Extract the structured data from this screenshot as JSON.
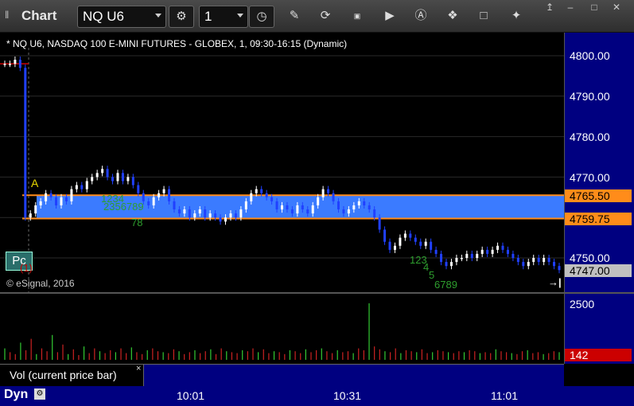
{
  "toolbar": {
    "title": "Chart",
    "symbol": "NQ U6",
    "interval": "1",
    "icons": [
      "settings-gear-icon",
      "clock-icon",
      "pencil-icon",
      "refresh-icon",
      "get-quote-icon",
      "play-icon",
      "alert-icon",
      "link-icon",
      "chat-icon",
      "twitter-icon"
    ],
    "window_controls": [
      "pin",
      "minimize",
      "maximize",
      "close"
    ]
  },
  "chart": {
    "header": "* NQ U6, NASDAQ 100 E-MINI FUTURES - GLOBEX, 1, 09:30-16:15 (Dynamic)",
    "copyright": "© eSignal, 2016",
    "pc_label": "Pc",
    "marker_a": "A",
    "marker_paren": "(1)",
    "end_arrow": "→|"
  },
  "price_axis": {
    "labels": [
      "4800.00",
      "4790.00",
      "4780.00",
      "4770.00",
      "4760.00",
      "4750.00"
    ],
    "tag_upper": "4765.50",
    "tag_lower": "4759.75",
    "tag_last": "4747.00",
    "colors": {
      "upper_bg": "#ff8c1a",
      "lower_bg": "#ff8c1a",
      "last_bg": "#c0c0c0",
      "axis_bg": "#000080"
    }
  },
  "volume": {
    "legend": "Vol (current price bar)",
    "close_icon": "×",
    "axis_label": "2500",
    "tag_last": "142",
    "colors": {
      "tag_bg": "#cc0000",
      "up": "#33cc33",
      "down": "#cc2222"
    }
  },
  "time_axis": {
    "mode": "Dyn",
    "labels": [
      "10:01",
      "10:31",
      "11:01"
    ]
  },
  "td_counts": {
    "left_upper": "1234",
    "left_mid": "2356789",
    "left_low": "78",
    "right_a": "123",
    "right_b": "4",
    "right_c": "5",
    "right_d": "6789"
  },
  "chart_data": {
    "type": "candlestick",
    "title": "* NQ U6, NASDAQ 100 E-MINI FUTURES - GLOBEX, 1, 09:30-16:15 (Dynamic)",
    "ylabel": "",
    "ylim": [
      4744,
      4803
    ],
    "y_ticks": [
      4800,
      4790,
      4780,
      4770,
      4760,
      4750
    ],
    "x_ticks": [
      "10:01",
      "10:31",
      "11:01"
    ],
    "value_area": {
      "high": 4765.5,
      "low": 4759.75
    },
    "last_price": 4747.0,
    "volume_ylim": [
      0,
      2500
    ],
    "volume_last": 142,
    "closes": [
      4798,
      4798,
      4799,
      4797,
      4760,
      4761,
      4763,
      4764,
      4766,
      4765,
      4763,
      4765,
      4764,
      4767,
      4768,
      4767,
      4769,
      4770,
      4771,
      4772,
      4770,
      4769,
      4771,
      4769,
      4770,
      4768,
      4766,
      4764,
      4763,
      4765,
      4766,
      4767,
      4764,
      4762,
      4761,
      4762,
      4760,
      4761,
      4762,
      4760,
      4761,
      4760,
      4759,
      4760,
      4761,
      4760,
      4762,
      4764,
      4766,
      4767,
      4766,
      4765,
      4764,
      4762,
      4763,
      4762,
      4761,
      4763,
      4762,
      4761,
      4763,
      4765,
      4767,
      4766,
      4764,
      4762,
      4761,
      4762,
      4763,
      4764,
      4763,
      4762,
      4760,
      4757,
      4754,
      4752,
      4753,
      4755,
      4756,
      4755,
      4754,
      4753,
      4754,
      4752,
      4751,
      4749,
      4748,
      4749,
      4750,
      4750,
      4751,
      4750,
      4751,
      4752,
      4751,
      4752,
      4753,
      4752,
      4751,
      4750,
      4749,
      4748,
      4749,
      4750,
      4749,
      4750,
      4749,
      4748,
      4747
    ],
    "volumes": [
      60,
      40,
      30,
      90,
      50,
      110,
      30,
      60,
      45,
      130,
      40,
      80,
      30,
      55,
      25,
      70,
      35,
      60,
      45,
      35,
      50,
      40,
      60,
      35,
      65,
      40,
      30,
      50,
      60,
      45,
      40,
      35,
      55,
      45,
      30,
      40,
      50,
      35,
      45,
      55,
      30,
      60,
      45,
      40,
      35,
      50,
      45,
      60,
      40,
      55,
      35,
      45,
      40,
      30,
      50,
      45,
      35,
      55,
      40,
      50,
      60,
      45,
      35,
      50,
      40,
      45,
      35,
      60,
      50,
      300,
      70,
      55,
      45,
      40,
      60,
      35,
      50,
      45,
      40,
      55,
      35,
      40,
      50,
      45,
      40,
      35,
      45,
      40,
      50,
      45,
      35,
      40,
      35,
      55,
      45,
      40,
      35,
      30,
      45,
      50,
      35,
      40,
      30,
      35,
      45,
      40
    ]
  }
}
